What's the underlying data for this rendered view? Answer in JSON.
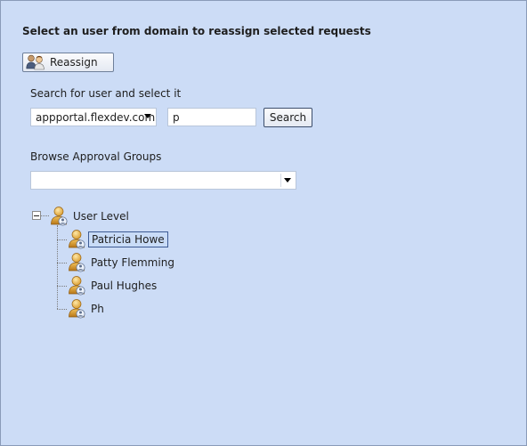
{
  "heading": "Select an user from domain to reassign selected requests",
  "reassign_button": {
    "label": "Reassign",
    "icon": "users-reassign-icon"
  },
  "search": {
    "label": "Search for user and select it",
    "domain": "appportal.flexdev.com",
    "query": "p",
    "button_label": "Search"
  },
  "browse": {
    "label": "Browse Approval Groups",
    "selected": ""
  },
  "tree": {
    "root": {
      "label": "User Level",
      "expanded": true,
      "icon": "user-group-icon"
    },
    "children": [
      {
        "label": "Patricia Howe",
        "selected": true,
        "icon": "user-icon"
      },
      {
        "label": "Patty Flemming",
        "selected": false,
        "icon": "user-icon"
      },
      {
        "label": "Paul Hughes",
        "selected": false,
        "icon": "user-icon"
      },
      {
        "label": "Ph",
        "selected": false,
        "icon": "user-icon"
      }
    ]
  }
}
